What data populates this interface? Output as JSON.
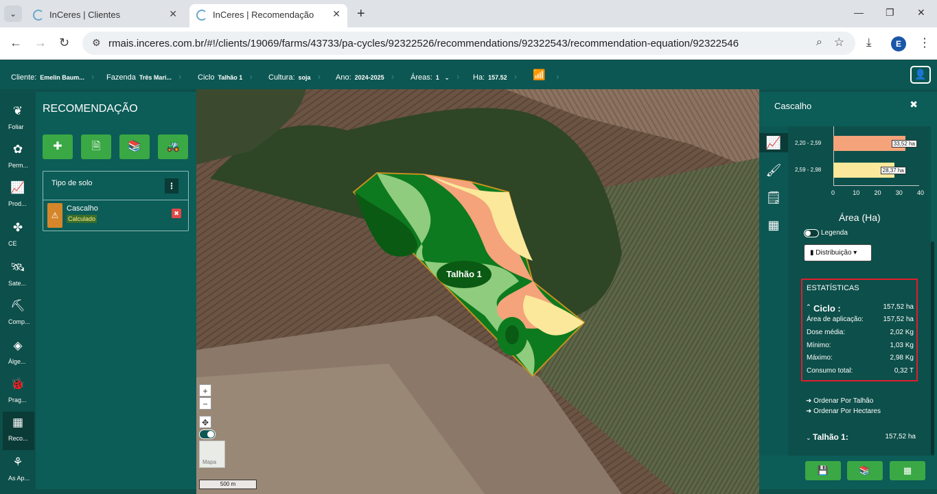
{
  "browser": {
    "tabs": [
      {
        "title": "InCeres | Clientes"
      },
      {
        "title": "InCeres | Recomendação"
      }
    ],
    "url": "rmais.inceres.com.br/#!/clients/19069/farms/43733/pa-cycles/92322526/recommendations/92322543/recommendation-equation/92322546",
    "profile_initial": "E"
  },
  "header": {
    "cliente_label": "Cliente:",
    "cliente_value": "Emelin Baum...",
    "fazenda_label": "Fazenda",
    "fazenda_value": "Três Mari...",
    "ciclo_label": "Ciclo",
    "ciclo_value": "Talhão 1",
    "cultura_label": "Cultura:",
    "cultura_value": "soja",
    "ano_label": "Ano:",
    "ano_value": "2024-2025",
    "areas_label": "Áreas:",
    "areas_value": "1",
    "ha_label": "Ha:",
    "ha_value": "157.52"
  },
  "rail": [
    {
      "label": "Foliar",
      "icon": "leaf-icon",
      "glyph": "❦"
    },
    {
      "label": "Perm...",
      "icon": "permanent-crop-icon",
      "glyph": "✿"
    },
    {
      "label": "Prod...",
      "icon": "chart-icon",
      "glyph": "📈"
    },
    {
      "label": "CE",
      "icon": "sprout-icon",
      "glyph": "✤"
    },
    {
      "label": "Sate...",
      "icon": "satellite-icon",
      "glyph": "🛰"
    },
    {
      "label": "Comp...",
      "icon": "compaction-icon",
      "glyph": "⛏"
    },
    {
      "label": "Álge...",
      "icon": "layers-icon",
      "glyph": "◈"
    },
    {
      "label": "Prag...",
      "icon": "bug-icon",
      "glyph": "🐞"
    },
    {
      "label": "Reco...",
      "icon": "recommendation-icon",
      "glyph": "▦"
    },
    {
      "label": "As Ap...",
      "icon": "sprayer-icon",
      "glyph": "⚘"
    }
  ],
  "left_panel": {
    "title": "RECOMENDAÇÃO",
    "card_header": "Tipo de solo",
    "item_name": "Cascalho",
    "item_badge": "Calculado"
  },
  "map": {
    "field_label": "Talhão 1",
    "minimap_label": "Mapa",
    "scale_label": "500 m"
  },
  "right_panel": {
    "title": "Cascalho",
    "colors": {
      "orange": "#f4a37a",
      "yellow": "#fbe89a"
    },
    "chart_data": {
      "type": "bar",
      "orientation": "horizontal",
      "categories": [
        "2,20 - 2,59",
        "2,59 - 2,98"
      ],
      "values": [
        33.52,
        28.37
      ],
      "value_labels": [
        "33,52 ha",
        "28,37 ha"
      ],
      "xlabel": "Área (Ha)",
      "xticks": [
        "0",
        "10",
        "20",
        "30",
        "40"
      ],
      "xlim": [
        0,
        40
      ]
    },
    "legend_label": "Legenda",
    "dist_button": "Distribuição",
    "stats_title": "ESTATÍSTICAS",
    "stats": [
      {
        "k": "Ciclo :",
        "v": "157,52 ha"
      },
      {
        "k": "Área de aplicação:",
        "v": "157,52 ha"
      },
      {
        "k": "Dose média:",
        "v": "2,02 Kg"
      },
      {
        "k": "Mínimo:",
        "v": "1,03 Kg"
      },
      {
        "k": "Máximo:",
        "v": "2,98 Kg"
      },
      {
        "k": "Consumo total:",
        "v": "0,32 T"
      }
    ],
    "order_talhao": "Ordenar Por Talhão",
    "order_hectares": "Ordenar Por Hectares",
    "talhao_label": "Talhão 1:",
    "talhao_value": "157,52 ha"
  }
}
